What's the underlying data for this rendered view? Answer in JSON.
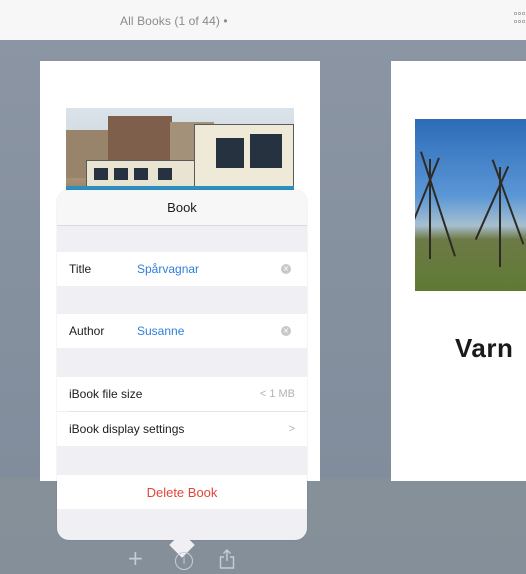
{
  "header": {
    "title": "All Books (1 of 44) •",
    "grid_icon": "grid-view-icon"
  },
  "books": [
    {
      "cover": "tram-photo"
    },
    {
      "cover": "park-photo",
      "title_partial": "Varn"
    }
  ],
  "popover": {
    "title": "Book",
    "title_row": {
      "label": "Title",
      "value": "Spårvagnar"
    },
    "author_row": {
      "label": "Author",
      "value": "Susanne"
    },
    "filesize_row": {
      "label": "iBook file size",
      "value": "< 1 MB"
    },
    "display_row": {
      "label": "iBook display settings",
      "chevron": ">"
    },
    "delete_label": "Delete Book"
  },
  "toolbar": {
    "icons": [
      "plus-icon",
      "info-icon",
      "share-icon"
    ]
  },
  "colors": {
    "accent": "#2f7fdc",
    "destructive": "#e2453c",
    "backdrop": "#818d9c"
  }
}
